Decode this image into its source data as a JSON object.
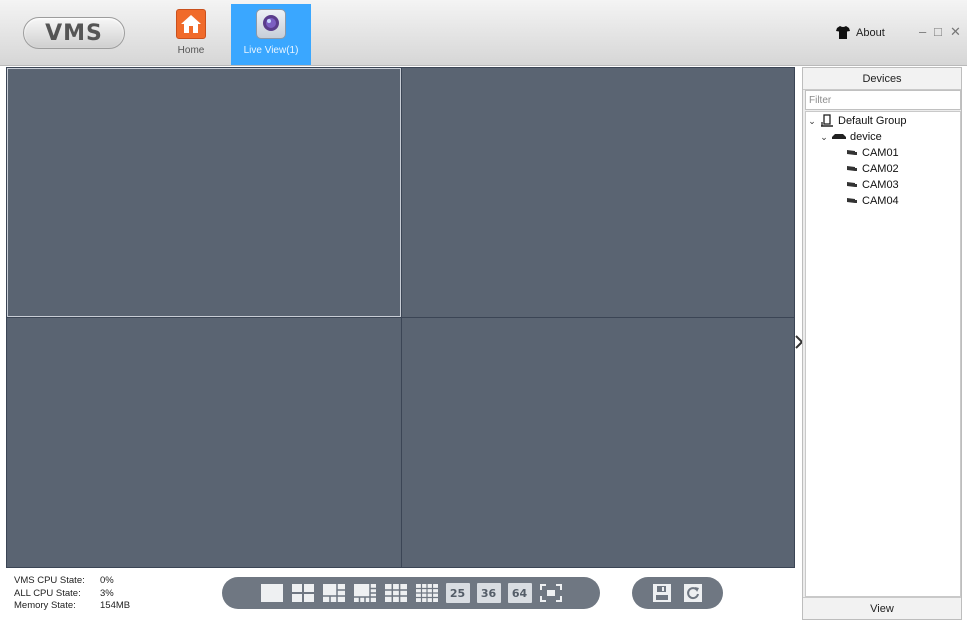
{
  "app": {
    "logo_text": "VMS"
  },
  "nav": {
    "tabs": [
      {
        "label": "Home",
        "icon": "home-icon",
        "active": false
      },
      {
        "label": "Live View(1)",
        "icon": "live-view-icon",
        "active": true
      }
    ]
  },
  "header_right": {
    "about_label": "About",
    "about_icon": "tshirt-icon",
    "minimize": "–",
    "maximize": "□",
    "close": "✕"
  },
  "video": {
    "layout": "2x2",
    "selected_cell": 1
  },
  "devices_panel": {
    "title": "Devices",
    "filter_placeholder": "Filter",
    "group": {
      "label": "Default Group",
      "icon": "group-icon",
      "expanded": true
    },
    "device": {
      "label": "device",
      "icon": "dvr-icon",
      "expanded": true
    },
    "cameras": [
      "CAM01",
      "CAM02",
      "CAM03",
      "CAM04"
    ],
    "footer": "View"
  },
  "status": {
    "vms_cpu_label": "VMS CPU State:",
    "vms_cpu_value": "0%",
    "all_cpu_label": "ALL CPU State:",
    "all_cpu_value": "3%",
    "memory_label": "Memory State:",
    "memory_value": "154MB"
  },
  "layout_toolbar": {
    "buttons": [
      "layout-1-icon",
      "layout-4-icon",
      "layout-6-icon",
      "layout-8-icon",
      "layout-9-icon",
      "layout-16-icon"
    ],
    "numbers": [
      "25",
      "36",
      "64"
    ],
    "fullscreen": "fullscreen-icon"
  },
  "action_toolbar": {
    "buttons": [
      "save-icon",
      "refresh-icon"
    ]
  },
  "colors": {
    "accent": "#3aa7ff",
    "video_cell": "#5a6472",
    "toolbar": "#6f7782",
    "home_icon": "#f06a2a"
  }
}
